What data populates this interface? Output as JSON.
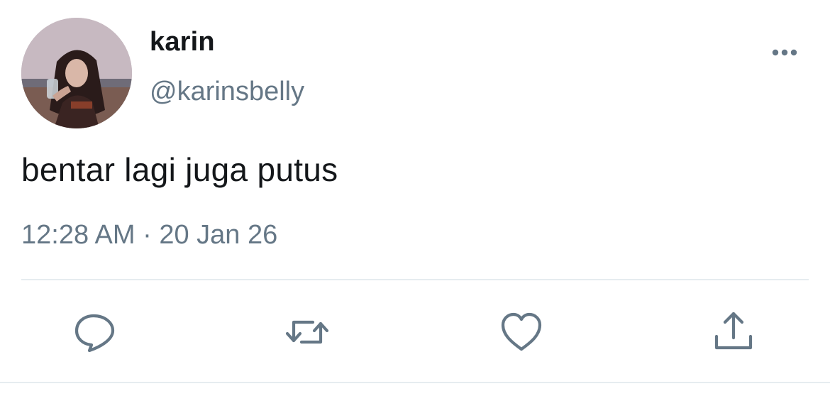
{
  "user": {
    "display_name": "karin",
    "handle": "@karinsbelly"
  },
  "tweet": {
    "text": "bentar lagi juga putus",
    "time": "12:28 AM",
    "separator": "·",
    "date": "20 Jan 26"
  },
  "actions": [
    {
      "name": "reply",
      "icon": "reply-icon"
    },
    {
      "name": "retweet",
      "icon": "retweet-icon"
    },
    {
      "name": "like",
      "icon": "heart-icon"
    },
    {
      "name": "share",
      "icon": "share-icon"
    }
  ],
  "colors": {
    "text_primary": "#14171a",
    "text_secondary": "#657786",
    "icon": "#657786",
    "divider": "#e6ecf0"
  }
}
